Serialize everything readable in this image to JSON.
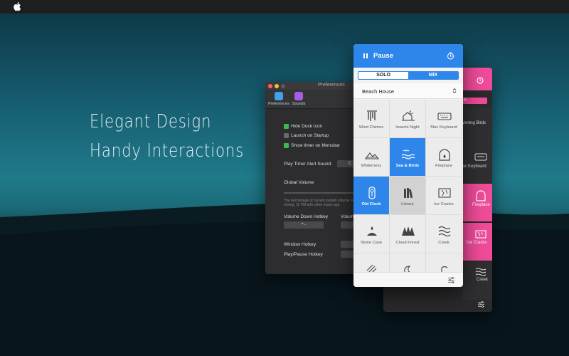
{
  "colors": {
    "accent_blue": "#2E86EA",
    "accent_pink": "#EE4B98",
    "checkbox_green": "#3DBA4E"
  },
  "menubar": {
    "logo_icon": "apple-icon"
  },
  "tagline": {
    "line1": "Elegant Design",
    "line2": "Handy Interactions"
  },
  "preferences": {
    "title": "Preferences",
    "tabs": [
      {
        "label": "Preferences",
        "icon": "preferences-icon",
        "selected": true
      },
      {
        "label": "Sounds",
        "icon": "sounds-icon",
        "selected": false
      }
    ],
    "options": [
      {
        "label": "Hide Dock Icon",
        "checked": true
      },
      {
        "label": "Launch on Startup",
        "checked": false
      },
      {
        "label": "Show timer on Menubar",
        "checked": true
      }
    ],
    "alert_sound_label": "Play Timer Alert Sound:",
    "alert_sound_value": "C",
    "global_volume_label": "Global Volume",
    "volume_note": "The percentage of current system volume. For mixing, Q! FM with other music app",
    "volume_down_hotkey_label": "Volume Down Hotkey",
    "volume_up_hotkey_label": "Volum",
    "volume_down_hotkey_value": "^ -",
    "window_hotkey_label": "Window Hotkey",
    "play_pause_hotkey_label": "Play/Pause Hotkey"
  },
  "back_window": {
    "segment_label": "X",
    "cells": [
      "vening Birds",
      "ac Keyboard",
      "Fireplace",
      "Ice Cracks",
      "Creek"
    ]
  },
  "main_window": {
    "header": {
      "pause_label": "Pause",
      "timer_icon": "timer-icon"
    },
    "segments": {
      "solo": "SOLO",
      "mix": "MIX",
      "selected": "MIX"
    },
    "preset": {
      "label": "Beach House"
    },
    "sounds": [
      {
        "label": "Wind Chimes",
        "icon": "wind-chimes-icon",
        "state": "normal"
      },
      {
        "label": "Insects Night",
        "icon": "insects-night-icon",
        "state": "normal"
      },
      {
        "label": "Mac Keyboard",
        "icon": "keyboard-icon",
        "state": "normal"
      },
      {
        "label": "Wilderness",
        "icon": "wilderness-icon",
        "state": "normal"
      },
      {
        "label": "Sea & Birds",
        "icon": "sea-birds-icon",
        "state": "active"
      },
      {
        "label": "Fireplace",
        "icon": "fireplace-icon",
        "state": "normal"
      },
      {
        "label": "Old Clock",
        "icon": "old-clock-icon",
        "state": "active"
      },
      {
        "label": "Library",
        "icon": "library-icon",
        "state": "hover"
      },
      {
        "label": "Ice Cracks",
        "icon": "ice-cracks-icon",
        "state": "normal"
      },
      {
        "label": "Stone Cave",
        "icon": "stone-cave-icon",
        "state": "normal"
      },
      {
        "label": "Cloud Forest",
        "icon": "cloud-forest-icon",
        "state": "normal"
      },
      {
        "label": "Creek",
        "icon": "creek-icon",
        "state": "normal"
      }
    ]
  }
}
